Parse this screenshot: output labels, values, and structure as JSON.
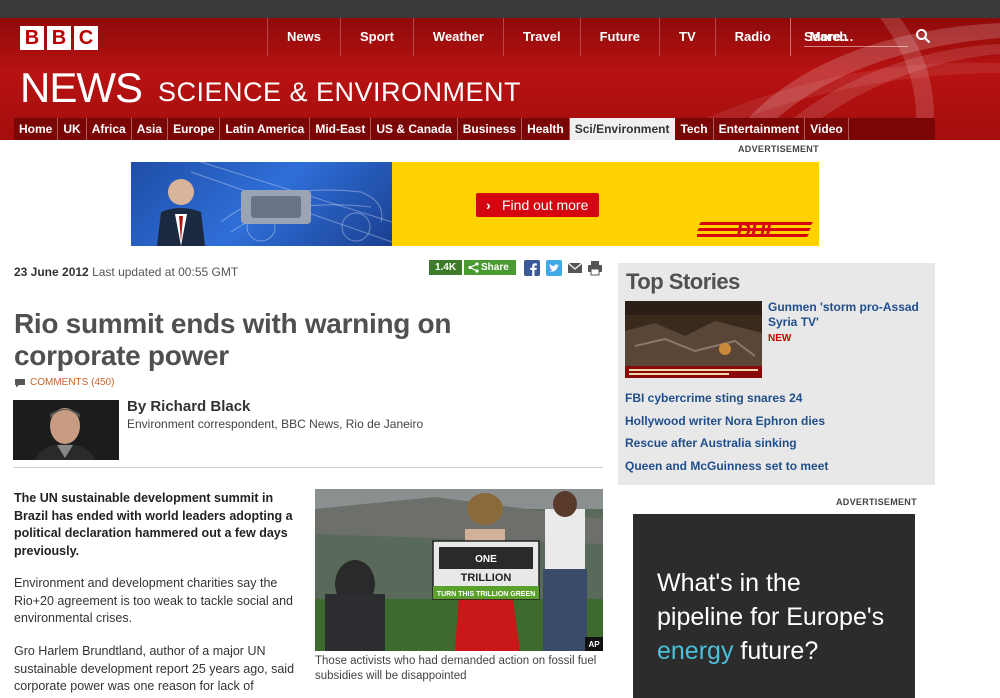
{
  "brand": {
    "logo_letters": [
      "B",
      "B",
      "C"
    ],
    "colors": {
      "primary_red": "#b81212",
      "link_blue": "#1f4e8a",
      "share_green": "#4a9a32",
      "dhl_yellow": "#ffd200",
      "dhl_red": "#d40511"
    }
  },
  "global_nav": {
    "items": [
      "News",
      "Sport",
      "Weather",
      "Travel",
      "Future",
      "TV",
      "Radio",
      "More…"
    ],
    "search_label": "Search",
    "search_icon": "magnifier-icon"
  },
  "section": {
    "news": "NEWS",
    "title": "SCIENCE & ENVIRONMENT"
  },
  "sub_nav": {
    "items": [
      "Home",
      "UK",
      "Africa",
      "Asia",
      "Europe",
      "Latin America",
      "Mid-East",
      "US & Canada",
      "Business",
      "Health",
      "Sci/Environment",
      "Tech",
      "Entertainment",
      "Video"
    ],
    "active": "Sci/Environment"
  },
  "ads": {
    "label": "ADVERTISEMENT",
    "banner_button": "Find out more",
    "banner_brand": "DHL",
    "side_ad": {
      "line1": "What's in the",
      "line2": "pipeline for Europe's",
      "line3_accent": "energy",
      "line3_rest": " future?"
    }
  },
  "article": {
    "date": "23 June 2012",
    "updated": "Last updated at 00:55 GMT",
    "share_count": "1.4K",
    "share_label": "Share",
    "headline": "Rio summit ends with warning on corporate power",
    "comments": "COMMENTS (450)",
    "author": {
      "name": "By Richard Black",
      "role": "Environment correspondent, BBC News, Rio de Janeiro"
    },
    "lead": "The UN sustainable development summit in Brazil has ended with world leaders adopting a political declaration hammered out a few days previously.",
    "paragraphs": [
      "Environment and development charities say the Rio+20 agreement is too weak to tackle social and environmental crises.",
      "Gro Harlem Brundtland, author of a major UN sustainable development report 25 years ago, said corporate power was one reason for lack of"
    ],
    "photo": {
      "credit": "AP",
      "banner_text": [
        "ONE",
        "TRILLION",
        "TURN THIS TRILLION GREEN"
      ]
    },
    "caption": "Those activists who had demanded action on fossil fuel subsidies will be disappointed"
  },
  "top_stories": {
    "title": "Top Stories",
    "lead": {
      "title": "Gunmen 'storm pro-Assad Syria TV'",
      "badge": "NEW"
    },
    "links": [
      "FBI cybercrime sting snares 24",
      "Hollywood writer Nora Ephron dies",
      "Rescue after Australia sinking",
      "Queen and McGuinness set to meet"
    ]
  }
}
